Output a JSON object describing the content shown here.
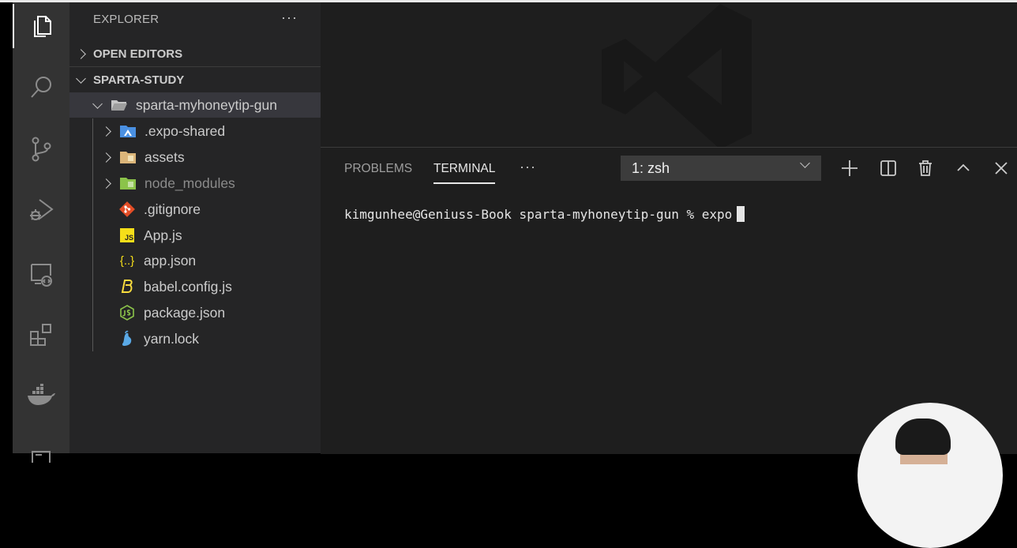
{
  "sidebar": {
    "title": "EXPLORER",
    "more": "···",
    "open_editors": "OPEN EDITORS",
    "workspace": "SPARTA-STUDY",
    "root_folder": "sparta-myhoneytip-gun",
    "items": [
      {
        "label": ".expo-shared",
        "icon": "expo-folder-icon"
      },
      {
        "label": "assets",
        "icon": "assets-folder-icon"
      },
      {
        "label": "node_modules",
        "icon": "node-folder-icon"
      },
      {
        "label": ".gitignore",
        "icon": "git-icon"
      },
      {
        "label": "App.js",
        "icon": "js-file-icon"
      },
      {
        "label": "app.json",
        "icon": "json-file-icon"
      },
      {
        "label": "babel.config.js",
        "icon": "babel-icon"
      },
      {
        "label": "package.json",
        "icon": "npm-package-icon"
      },
      {
        "label": "yarn.lock",
        "icon": "yarn-icon"
      }
    ],
    "icons": {
      "js": "JS",
      "json": "{..}"
    }
  },
  "panel": {
    "tabs": [
      "PROBLEMS",
      "TERMINAL"
    ],
    "active_tab": "TERMINAL",
    "more": "···",
    "terminal_select": "1: zsh",
    "terminal_line": "kimgunhee@Geniuss-Book sparta-myhoneytip-gun % expo"
  },
  "colors": {
    "activity_bar": "#333333",
    "sidebar": "#252526",
    "editor": "#1e1e1e",
    "selection": "#37373d",
    "expo_blue": "#4a90e2",
    "folder_yellow": "#dcb67a",
    "node_green": "#8bc34a",
    "git_orange": "#e44d26",
    "js_yellow": "#f5de19",
    "babel_yellow": "#f9dc3e",
    "npm_green": "#8bc34a",
    "yarn_blue": "#2c8ebb"
  }
}
